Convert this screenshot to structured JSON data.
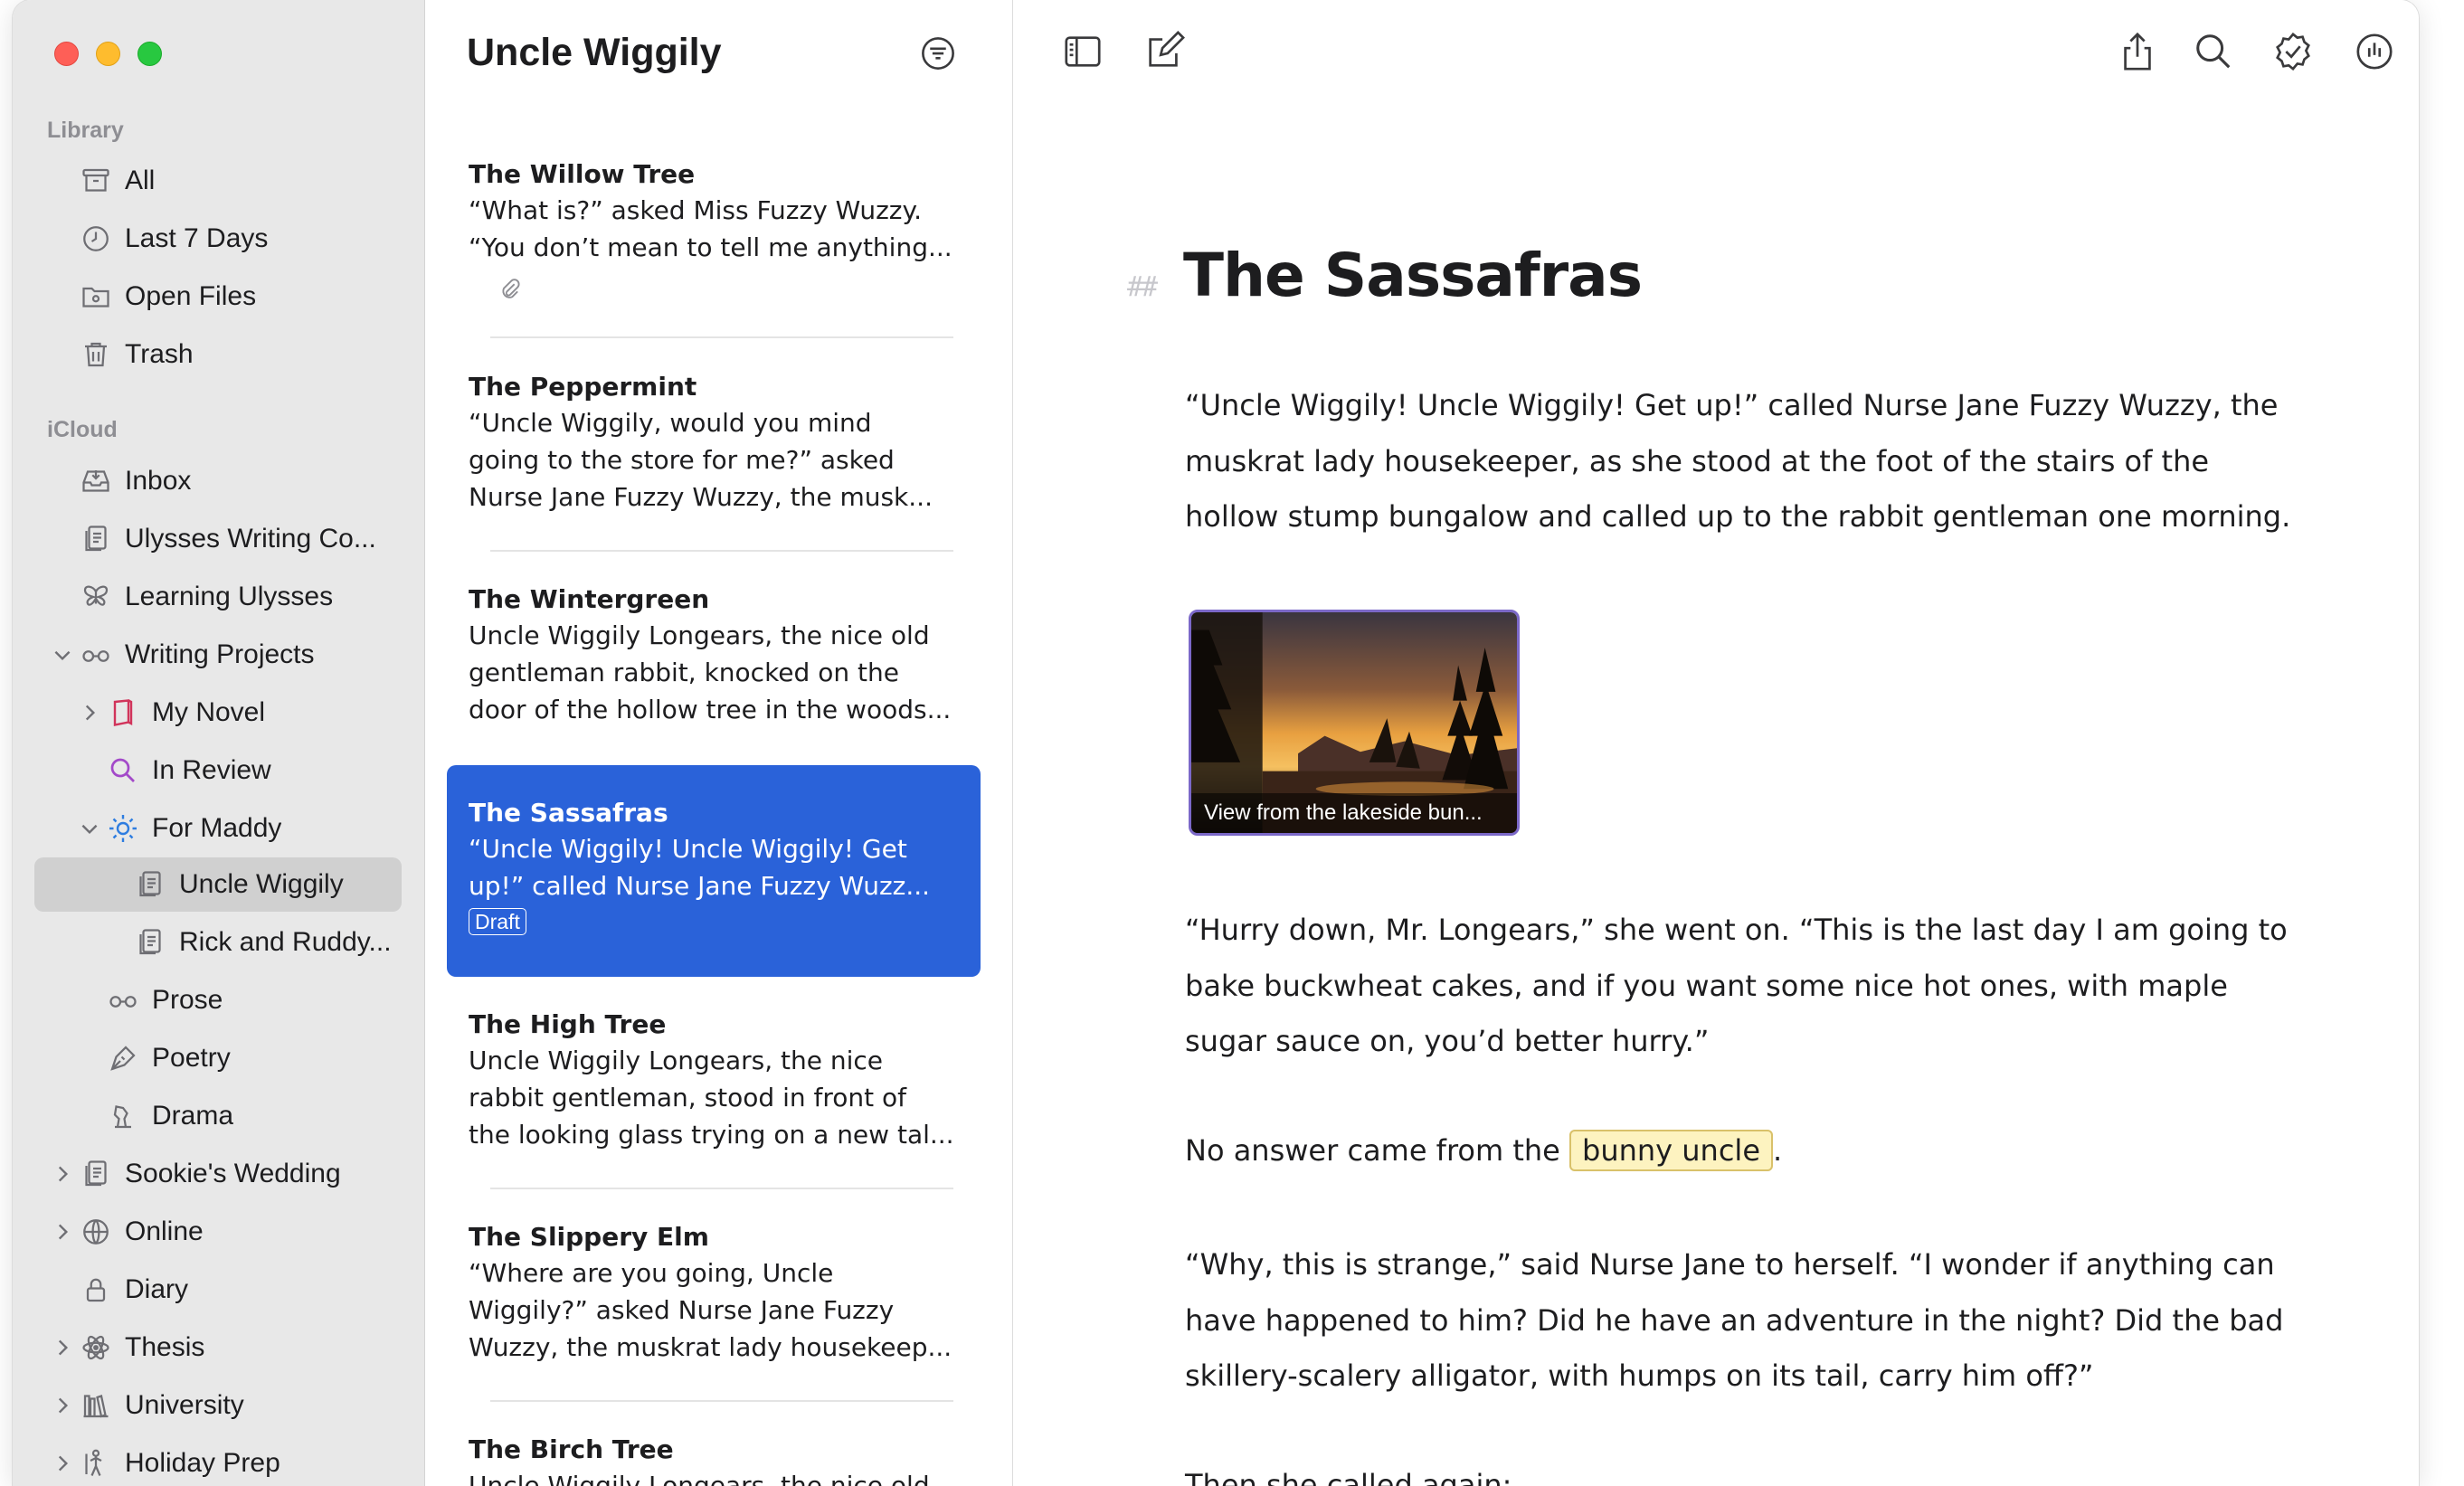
{
  "sidebar": {
    "library_heading": "Library",
    "library": [
      {
        "label": "All",
        "icon": "archive-box-icon"
      },
      {
        "label": "Last 7 Days",
        "icon": "clock-icon"
      },
      {
        "label": "Open Files",
        "icon": "folder-icon"
      },
      {
        "label": "Trash",
        "icon": "trash-icon"
      }
    ],
    "icloud_heading": "iCloud",
    "icloud": [
      {
        "label": "Inbox",
        "icon": "inbox-tray-icon"
      },
      {
        "label": "Ulysses Writing Co...",
        "icon": "document-stack-icon"
      },
      {
        "label": "Learning Ulysses",
        "icon": "butterfly-icon"
      },
      {
        "label": "Writing Projects",
        "icon": "glasses-icon"
      },
      {
        "label": "My Novel",
        "icon": "book-icon"
      },
      {
        "label": "In Review",
        "icon": "magnifier-icon"
      },
      {
        "label": "For Maddy",
        "icon": "sun-icon"
      },
      {
        "label": "Uncle Wiggily",
        "icon": "document-icon"
      },
      {
        "label": "Rick and Ruddy...",
        "icon": "document-icon"
      },
      {
        "label": "Prose",
        "icon": "glasses-icon"
      },
      {
        "label": "Poetry",
        "icon": "pen-nib-icon"
      },
      {
        "label": "Drama",
        "icon": "theater-icon"
      },
      {
        "label": "Sookie's Wedding",
        "icon": "document-stack-icon"
      },
      {
        "label": "Online",
        "icon": "globe-icon"
      },
      {
        "label": "Diary",
        "icon": "lock-icon"
      },
      {
        "label": "Thesis",
        "icon": "atom-icon"
      },
      {
        "label": "University",
        "icon": "books-icon"
      },
      {
        "label": "Holiday Prep",
        "icon": "figure-icon"
      }
    ]
  },
  "list": {
    "title": "Uncle Wiggily",
    "sheets": [
      {
        "title": "The Willow Tree",
        "lines": [
          "“What is?” asked Miss Fuzzy Wuzzy.",
          "“You don’t mean to tell me anything..."
        ]
      },
      {
        "title": "The Peppermint",
        "lines": [
          "“Uncle Wiggily, would you mind",
          "going to the store for me?” asked",
          "Nurse Jane Fuzzy Wuzzy, the musk..."
        ]
      },
      {
        "title": "The Wintergreen",
        "lines": [
          "Uncle Wiggily Longears, the nice old",
          "gentleman rabbit, knocked on the",
          "door of the hollow tree in the woods..."
        ]
      },
      {
        "title": "The Sassafras",
        "lines": [
          "“Uncle Wiggily! Uncle Wiggily! Get",
          "up!” called Nurse Jane Fuzzy Wuzz..."
        ],
        "badge": "Draft"
      },
      {
        "title": "The High Tree",
        "lines": [
          "Uncle Wiggily Longears, the nice",
          "rabbit gentleman, stood in front of",
          "the looking glass trying on a new tal..."
        ]
      },
      {
        "title": "The Slippery Elm",
        "lines": [
          "“Where are you going, Uncle",
          "Wiggily?” asked Nurse Jane Fuzzy",
          "Wuzzy, the muskrat lady housekeep..."
        ]
      },
      {
        "title": "The Birch Tree",
        "lines": [
          "Uncle Wiggily Longears, the nice old"
        ]
      }
    ]
  },
  "editor": {
    "heading_marker": "##",
    "title": "The Sassafras",
    "para1": "“Uncle Wiggily! Uncle Wiggily! Get up!” called Nurse Jane Fuzzy Wuzzy, the muskrat lady housekeeper, as she stood at the foot of the stairs of the hollow stump bungalow and called up to the rabbit gentleman one morning.",
    "image_caption": "View from the lakeside bun...",
    "para2": "“Hurry down, Mr. Longears,” she went on. “This is the last day I am going to bake buckwheat cakes, and if you want some nice hot ones, with maple sugar sauce on, you’d better hurry.”",
    "para3_before": "No answer came from the",
    "para3_highlight": "bunny uncle",
    "para3_after": ".",
    "para4": "“Why, this is strange,” said Nurse Jane to herself. “I wonder if anything can have happened to him? Did he have an adventure in the night? Did the bad skillery-scalery alligator, with humps on its tail, carry him off?”",
    "para5": "Then she called again:"
  },
  "colors": {
    "accent": "#2a62d9",
    "sidebar_bg": "#e8e8e8",
    "highlight_bg": "#fdf3c0"
  }
}
